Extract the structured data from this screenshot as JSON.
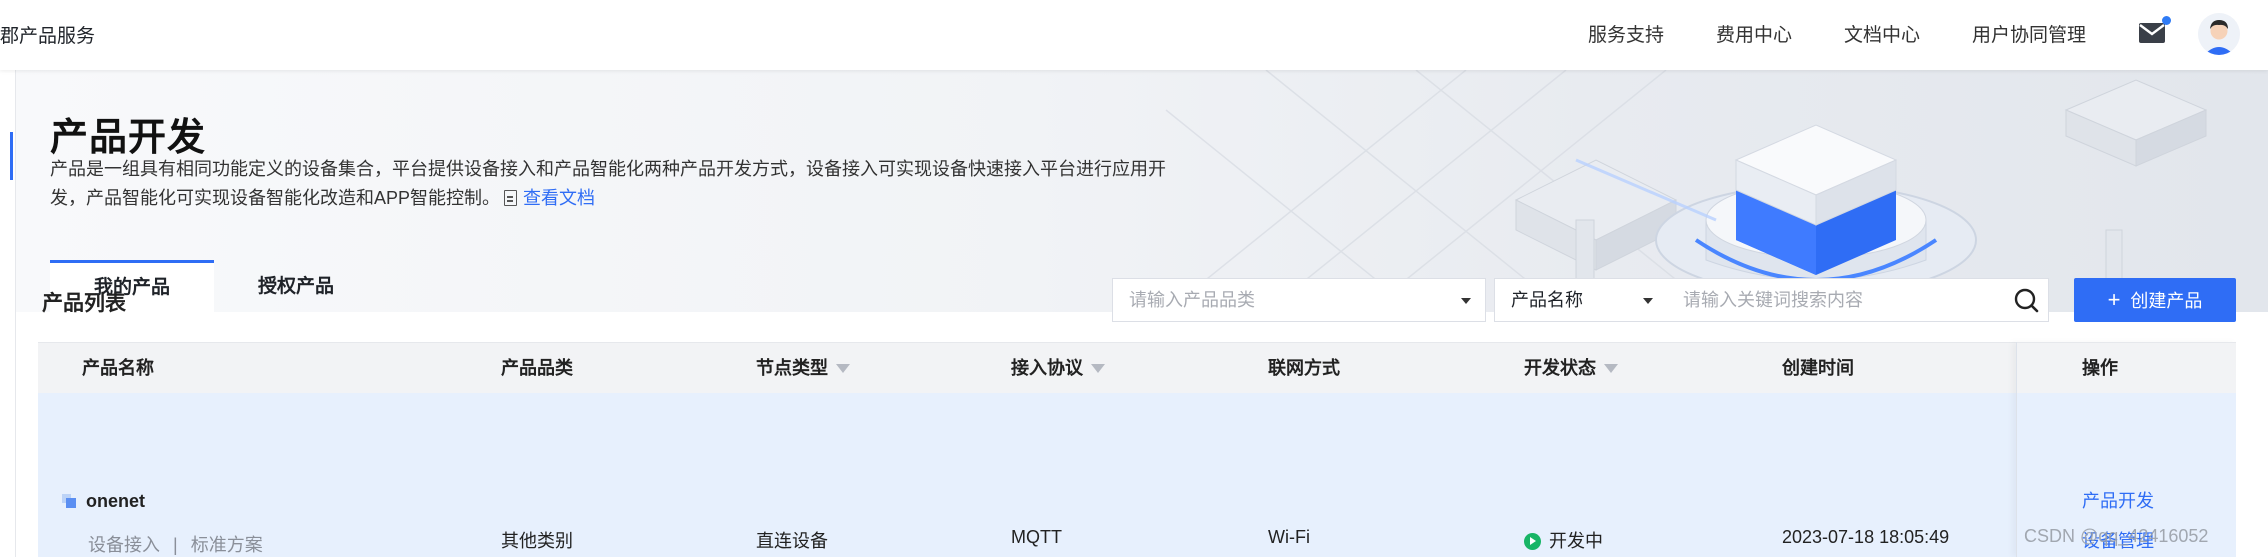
{
  "topbar": {
    "crumb": "郡产品服务",
    "nav": [
      "服务支持",
      "费用中心",
      "文档中心",
      "用户协同管理"
    ],
    "icons": [
      "mail-icon",
      "avatar"
    ],
    "accent": "#2f6df5"
  },
  "header": {
    "title": "产品开发",
    "description": "产品是一组具有相同功能定义的设备集合，平台提供设备接入和产品智能化两种产品开发方式，设备接入可实现设备快速接入平台进行应用开发，产品智能化可实现设备智能化改造和APP智能控制。",
    "doc_link": "查看文档",
    "tabs": [
      "我的产品",
      "授权产品"
    ]
  },
  "list": {
    "title": "产品列表",
    "category_placeholder": "请输入产品品类",
    "field_select": "产品名称",
    "keyword_placeholder": "请输入关键词搜索内容",
    "create_button": "创建产品",
    "columns": [
      "产品名称",
      "产品品类",
      "节点类型",
      "接入协议",
      "联网方式",
      "开发状态",
      "创建时间",
      "操作"
    ],
    "rows": [
      {
        "name": "onenet",
        "access": "设备接入",
        "separator": "|",
        "scheme": "标准方案",
        "category": "其他类别",
        "node_type": "直连设备",
        "protocol": "MQTT",
        "network": "Wi-Fi",
        "status": "开发中",
        "created": "2023-07-18 18:05:49",
        "actions": [
          "产品开发",
          "设备管理"
        ]
      }
    ]
  },
  "watermark": "CSDN @qq_42416052"
}
